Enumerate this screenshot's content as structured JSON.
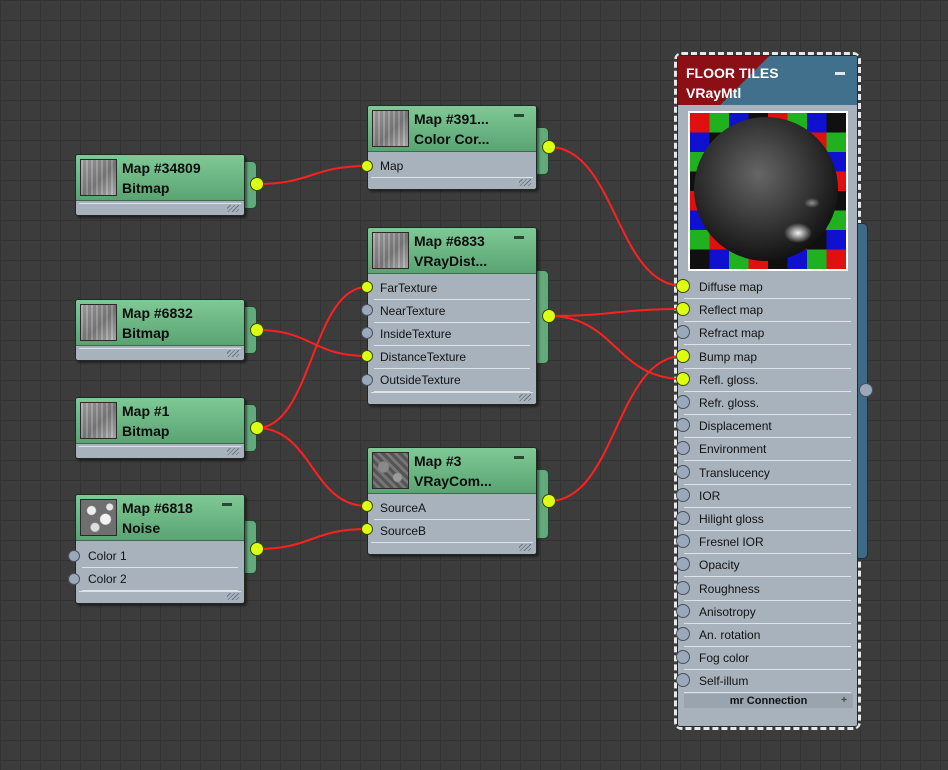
{
  "nodes": {
    "map34809": {
      "title": "Map #34809",
      "type": "Bitmap",
      "thumb": "wood-texture-thumbnail"
    },
    "map6832": {
      "title": "Map #6832",
      "type": "Bitmap",
      "thumb": "wood-texture-thumbnail"
    },
    "map1": {
      "title": "Map #1",
      "type": "Bitmap",
      "thumb": "wood-texture-thumbnail"
    },
    "map6818": {
      "title": "Map #6818",
      "type": "Noise",
      "thumb": "noise-thumbnail",
      "inputs": [
        "Color 1",
        "Color 2"
      ]
    },
    "map391": {
      "title": "Map #391...",
      "type": "Color Cor...",
      "thumb": "wood-texture-thumbnail",
      "inputs": [
        "Map"
      ]
    },
    "map6833": {
      "title": "Map #6833",
      "type": "VRayDist...",
      "thumb": "wood-texture-thumbnail",
      "inputs": [
        "FarTexture",
        "NearTexture",
        "InsideTexture",
        "DistanceTexture",
        "OutsideTexture"
      ]
    },
    "map3": {
      "title": "Map #3",
      "type": "VRayCom...",
      "thumb": "dark-texture-thumbnail",
      "inputs": [
        "SourceA",
        "SourceB"
      ]
    }
  },
  "material": {
    "name": "FLOOR TILES",
    "type": "VRayMtl",
    "preview": "material-sphere-preview",
    "slots": [
      "Diffuse map",
      "Reflect map",
      "Refract map",
      "Bump map",
      "Refl. gloss.",
      "Refr. gloss.",
      "Displacement",
      "Environment",
      "Translucency",
      "IOR",
      "Hilight gloss",
      "Fresnel IOR",
      "Opacity",
      "Roughness",
      "Anisotropy",
      "An. rotation",
      "Fog color",
      "Self-illum"
    ],
    "footer": "mr Connection"
  },
  "colors": {
    "canvas": "#3c3c3c",
    "grid": "#333333",
    "node_header": "#6bb585",
    "node_body": "#a8b2bc",
    "material_header_red": "#8c0f16",
    "material_header_blue": "#41708c",
    "wire": "#ff2020",
    "socket_connected": "#dcff14",
    "socket_empty": "#9aa8bc"
  },
  "connections": [
    {
      "from": "Map #34809",
      "to": "Map #391... / Map"
    },
    {
      "from": "Map #6832",
      "to": "Map #6833 / DistanceTexture"
    },
    {
      "from": "Map #1",
      "to": "Map #6833 / FarTexture"
    },
    {
      "from": "Map #1",
      "to": "Map #3 / SourceA"
    },
    {
      "from": "Map #6818",
      "to": "Map #3 / SourceB"
    },
    {
      "from": "Map #391...",
      "to": "FLOOR TILES / Diffuse map"
    },
    {
      "from": "Map #6833",
      "to": "FLOOR TILES / Reflect map"
    },
    {
      "from": "Map #6833",
      "to": "FLOOR TILES / Refl. gloss."
    },
    {
      "from": "Map #3",
      "to": "FLOOR TILES / Bump map"
    }
  ]
}
